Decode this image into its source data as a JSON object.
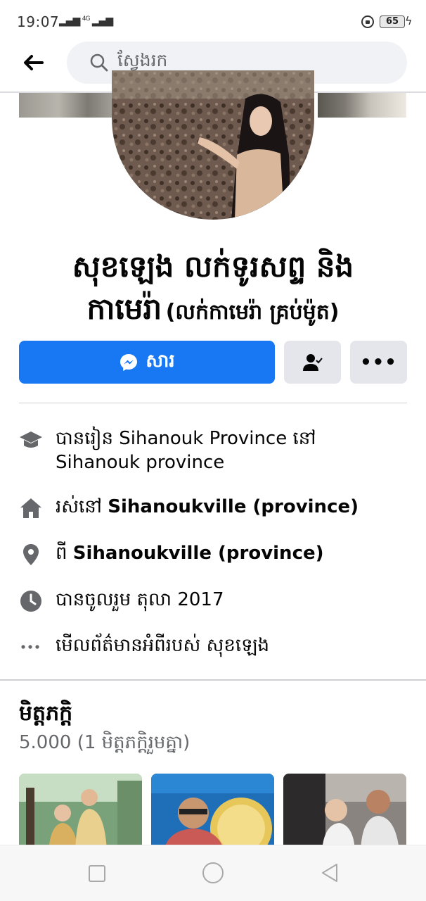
{
  "status_bar": {
    "time": "19:07",
    "network": "4G",
    "battery": "65"
  },
  "header": {
    "search_placeholder": "ស្វែងរក"
  },
  "profile": {
    "name_line1": "សុខឡេង លក់ទូរសព្ទ និង",
    "name_line2_main": "កាមេរ៉ា",
    "name_line2_sub": "(លក់កាមេរ៉ា គ្រប់ម៉ូត)"
  },
  "actions": {
    "message_label": "សារ"
  },
  "intro": {
    "education_line1": "បានរៀន Sihanouk Province នៅ",
    "education_line2": "Sihanouk province",
    "lives_prefix": "រស់នៅ",
    "lives_place": "Sihanoukville (province)",
    "from_prefix": "ពី",
    "from_place": "Sihanoukville (province)",
    "joined": "បានចូលរួម តុលា 2017",
    "see_more": "មើលព័ត៌មានអំពីរបស់ សុខឡេង"
  },
  "friends": {
    "title": "មិត្តភក្តិ",
    "count": "5.000 (1 មិត្តភក្តិរួមគ្នា)"
  },
  "colors": {
    "primary": "#1877f2",
    "secondary_button": "#e4e6eb",
    "icon_gray": "#65676b",
    "divider": "#ced0d4"
  },
  "icons": {
    "back": "arrow-left-icon",
    "search": "search-icon",
    "messenger": "messenger-icon",
    "friend_status": "person-check-icon",
    "more": "more-horizontal-icon",
    "education": "graduation-cap-icon",
    "home": "home-icon",
    "location": "location-pin-icon",
    "clock": "clock-icon",
    "ellipsis": "ellipsis-icon"
  }
}
